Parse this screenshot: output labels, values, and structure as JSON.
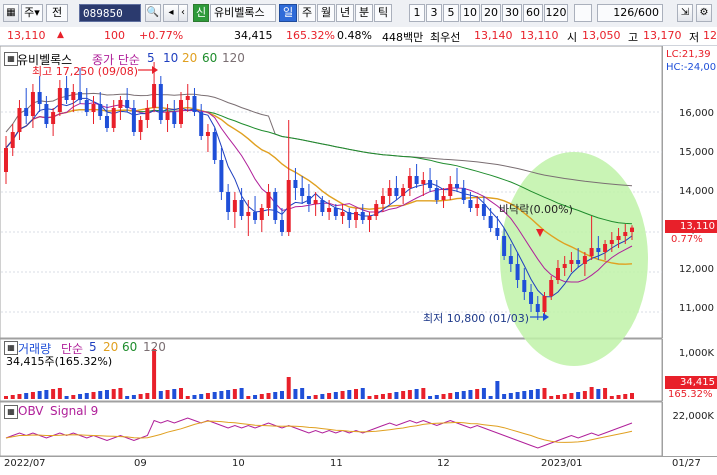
{
  "toolbar": {
    "market": "주",
    "prev_label": "전",
    "code": "089850",
    "new_badge": "신",
    "stock_name": "유비벨록스",
    "periods": [
      "일",
      "주",
      "월",
      "년",
      "분",
      "틱"
    ],
    "active_period": "일",
    "intervals": [
      "1",
      "3",
      "5",
      "10",
      "20",
      "30",
      "60",
      "120"
    ],
    "count": "126",
    "count_total": "/600"
  },
  "quote": {
    "price": "13,110",
    "change": "100",
    "change_pct": "+0.77%",
    "volume": "34,415",
    "volume_ratio": "165.32%",
    "turnover": "0.48%",
    "amount": "448백만",
    "best_ask_label": "최우선",
    "best_ask": "13,140",
    "best_bid": "13,110",
    "open_label": "시",
    "open": "13,050",
    "high_label": "고",
    "high": "13,170",
    "low_label": "저",
    "low": "12,8"
  },
  "price_panel": {
    "legend_name": "유비벨록스",
    "legend_ma": "종가 단순",
    "legend_periods": [
      "5",
      "10",
      "20",
      "60",
      "120"
    ],
    "high_note": "최고 17,250 (09/08)",
    "low_note": "최저 10,800 (01/03)",
    "annotation": "바닥락(0.00%)",
    "lc": "LC:21,39",
    "hc": "HC:-24,00",
    "last_price": "13,110",
    "last_pct": "0.77%",
    "y_ticks": [
      "16,000",
      "15,000",
      "14,000",
      "13,000",
      "12,000",
      "11,000"
    ]
  },
  "volume_panel": {
    "legend_name": "거래량",
    "legend_ma": "단순",
    "legend_periods": [
      "5",
      "20",
      "60",
      "120"
    ],
    "value_line": "34,415주(165.32%)",
    "y_tick": "1,000K",
    "last_value": "34,415",
    "last_pct": "165.32%"
  },
  "obv_panel": {
    "legend_obv": "OBV",
    "legend_signal": "Signal 9",
    "y_tick": "22,000K"
  },
  "x_axis": [
    "2022/07",
    "09",
    "10",
    "11",
    "12",
    "2023/01",
    "01/27"
  ],
  "colors": {
    "up": "#e8202a",
    "down": "#1f4fd8",
    "ma5": "#1f3fbf",
    "ma10": "#b0209a",
    "ma20": "#e0a020",
    "ma60": "#1e8c2c",
    "ma120": "#7a6e72",
    "highlight": "#b8f0a0"
  },
  "chart_data": {
    "type": "candlestick",
    "x_range": [
      "2022/07",
      "2023/01/27"
    ],
    "y_range": [
      10500,
      17300
    ],
    "high": {
      "value": 17250,
      "date": "09/08"
    },
    "low": {
      "value": 10800,
      "date": "01/03"
    },
    "last_close": 13110,
    "candles": [
      [
        14500,
        15400,
        14200,
        15100
      ],
      [
        15100,
        15700,
        14900,
        15500
      ],
      [
        15500,
        16300,
        15300,
        16100
      ],
      [
        16100,
        16600,
        15700,
        15900
      ],
      [
        15900,
        16700,
        15600,
        16500
      ],
      [
        16500,
        16900,
        16000,
        16200
      ],
      [
        16200,
        16400,
        15600,
        15700
      ],
      [
        15700,
        16100,
        15400,
        16000
      ],
      [
        16000,
        16800,
        15900,
        16600
      ],
      [
        16600,
        16900,
        16200,
        16300
      ],
      [
        16300,
        16700,
        16000,
        16500
      ],
      [
        16500,
        17100,
        16200,
        16300
      ],
      [
        16300,
        16600,
        15900,
        16000
      ],
      [
        16000,
        16400,
        15700,
        16200
      ],
      [
        16200,
        16500,
        15800,
        15900
      ],
      [
        15900,
        16200,
        15500,
        15600
      ],
      [
        15600,
        16300,
        15500,
        16100
      ],
      [
        16100,
        16400,
        15800,
        16300
      ],
      [
        16300,
        16600,
        16000,
        16100
      ],
      [
        16100,
        16300,
        15400,
        15500
      ],
      [
        15500,
        15900,
        15300,
        15800
      ],
      [
        15800,
        16300,
        15600,
        16100
      ],
      [
        16100,
        17250,
        16000,
        16700
      ],
      [
        16700,
        16900,
        15700,
        15800
      ],
      [
        15800,
        16200,
        15500,
        16000
      ],
      [
        16000,
        16300,
        15600,
        15700
      ],
      [
        15700,
        16500,
        15600,
        16300
      ],
      [
        16300,
        16700,
        16000,
        16400
      ],
      [
        16400,
        16600,
        15900,
        16000
      ],
      [
        16000,
        16200,
        15300,
        15400
      ],
      [
        15400,
        15700,
        15000,
        15500
      ],
      [
        15500,
        15600,
        14700,
        14800
      ],
      [
        14800,
        15100,
        13800,
        14000
      ],
      [
        14000,
        14200,
        13300,
        13500
      ],
      [
        13500,
        14000,
        13100,
        13800
      ],
      [
        13800,
        14100,
        13300,
        13400
      ],
      [
        13400,
        13800,
        12900,
        13500
      ],
      [
        13500,
        13900,
        13200,
        13300
      ],
      [
        13300,
        13700,
        13000,
        13600
      ],
      [
        13600,
        14200,
        13400,
        14000
      ],
      [
        14000,
        14100,
        13200,
        13300
      ],
      [
        13300,
        13600,
        12900,
        13000
      ],
      [
        13000,
        15800,
        12900,
        14300
      ],
      [
        14300,
        14600,
        13800,
        14100
      ],
      [
        14100,
        14400,
        13700,
        13900
      ],
      [
        13900,
        14200,
        13500,
        13700
      ],
      [
        13700,
        14000,
        13400,
        13800
      ],
      [
        13800,
        13900,
        13400,
        13500
      ],
      [
        13500,
        13800,
        13300,
        13600
      ],
      [
        13600,
        13700,
        13300,
        13400
      ],
      [
        13400,
        13700,
        13200,
        13500
      ],
      [
        13500,
        13600,
        13100,
        13300
      ],
      [
        13300,
        13600,
        13100,
        13500
      ],
      [
        13500,
        13700,
        13200,
        13300
      ],
      [
        13300,
        13500,
        13000,
        13400
      ],
      [
        13400,
        13800,
        13300,
        13700
      ],
      [
        13700,
        14100,
        13500,
        13900
      ],
      [
        13900,
        14300,
        13700,
        14100
      ],
      [
        14100,
        14400,
        13800,
        13900
      ],
      [
        13900,
        14200,
        13700,
        14100
      ],
      [
        14100,
        14600,
        13900,
        14400
      ],
      [
        14400,
        14700,
        14100,
        14200
      ],
      [
        14200,
        14500,
        13900,
        14300
      ],
      [
        14300,
        14600,
        14000,
        14100
      ],
      [
        14100,
        14300,
        13700,
        13800
      ],
      [
        13800,
        14100,
        13600,
        13900
      ],
      [
        13900,
        14400,
        13800,
        14200
      ],
      [
        14200,
        14600,
        14000,
        14100
      ],
      [
        14100,
        14300,
        13700,
        13800
      ],
      [
        13800,
        14000,
        13500,
        13600
      ],
      [
        13600,
        13900,
        13400,
        13700
      ],
      [
        13700,
        13900,
        13300,
        13400
      ],
      [
        13400,
        13600,
        13000,
        13100
      ],
      [
        13100,
        13400,
        12800,
        12900
      ],
      [
        12900,
        13100,
        12300,
        12400
      ],
      [
        12400,
        12700,
        12000,
        12200
      ],
      [
        12200,
        12500,
        11600,
        11800
      ],
      [
        11800,
        12100,
        11300,
        11500
      ],
      [
        11500,
        11700,
        11000,
        11200
      ],
      [
        11200,
        11400,
        10800,
        11000
      ],
      [
        11000,
        11500,
        10900,
        11400
      ],
      [
        11400,
        11900,
        11300,
        11800
      ],
      [
        11800,
        12300,
        11700,
        12100
      ],
      [
        12100,
        12400,
        11900,
        12200
      ],
      [
        12200,
        12500,
        12000,
        12300
      ],
      [
        12300,
        12600,
        12100,
        12200
      ],
      [
        12200,
        12500,
        11900,
        12400
      ],
      [
        12400,
        13400,
        12300,
        12600
      ],
      [
        12600,
        12900,
        12300,
        12500
      ],
      [
        12500,
        12800,
        12300,
        12700
      ],
      [
        12700,
        13000,
        12500,
        12800
      ],
      [
        12800,
        13100,
        12600,
        12900
      ],
      [
        12900,
        13200,
        12700,
        13000
      ],
      [
        13000,
        13170,
        12800,
        13110
      ]
    ],
    "volume_spikes": {
      "09/08": "spike",
      "12/01": "spike"
    }
  }
}
